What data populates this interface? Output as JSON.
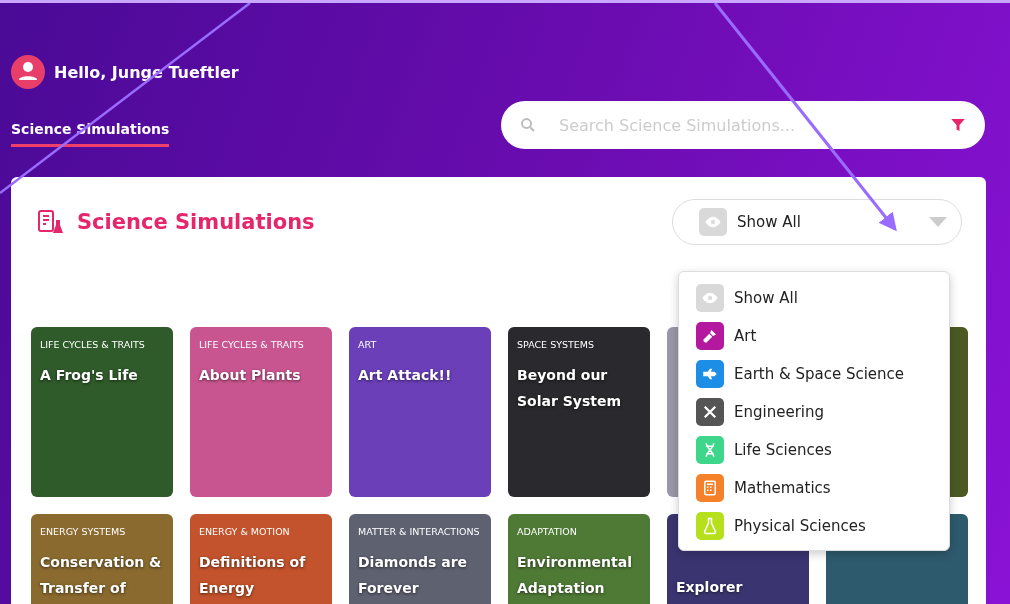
{
  "greeting": "Hello, Junge Tueftler",
  "nav_tab": {
    "label": "Science Simulations",
    "selected": true
  },
  "search": {
    "placeholder": "Search Science Simulations..."
  },
  "panel": {
    "title": "Science Simulations"
  },
  "filter": {
    "value": "Show All",
    "expanded": true,
    "options": [
      {
        "label": "Show All",
        "color": "#d9d9d9"
      },
      {
        "label": "Art",
        "color": "#b3189e"
      },
      {
        "label": "Earth & Space Science",
        "color": "#1c8ee6"
      },
      {
        "label": "Engineering",
        "color": "#555555"
      },
      {
        "label": "Life Sciences",
        "color": "#3ed68a"
      },
      {
        "label": "Mathematics",
        "color": "#f5812a"
      },
      {
        "label": "Physical Sciences",
        "color": "#b6e01c"
      }
    ]
  },
  "cards": [
    {
      "category": "LIFE CYCLES & TRAITS",
      "title": "A Frog's Life",
      "color": "#2f5a2a"
    },
    {
      "category": "LIFE CYCLES & TRAITS",
      "title": "About Plants",
      "color": "#c8558f"
    },
    {
      "category": "ART",
      "title": "Art Attack!!",
      "color": "#6b3fb8"
    },
    {
      "category": "SPACE SYSTEMS",
      "title": "Beyond our Solar System",
      "color": "#2a2a2e"
    },
    {
      "color": "#9a98a8"
    },
    {
      "color": "#4b5a22"
    },
    {
      "category": "ENERGY SYSTEMS",
      "title": "Conservation & Transfer of",
      "color": "#8a6a2e"
    },
    {
      "category": "ENERGY & MOTION",
      "title": "Definitions of Energy",
      "color": "#c2532c"
    },
    {
      "category": "MATTER & INTERACTIONS",
      "title": "Diamonds are Forever",
      "color": "#5d6170"
    },
    {
      "category": "ADAPTATION",
      "title": "Environmental Adaptation",
      "color": "#4f7a35"
    },
    {
      "title": "Explorer",
      "color": "#3a3570"
    },
    {
      "color": "#2e5a6e"
    }
  ]
}
